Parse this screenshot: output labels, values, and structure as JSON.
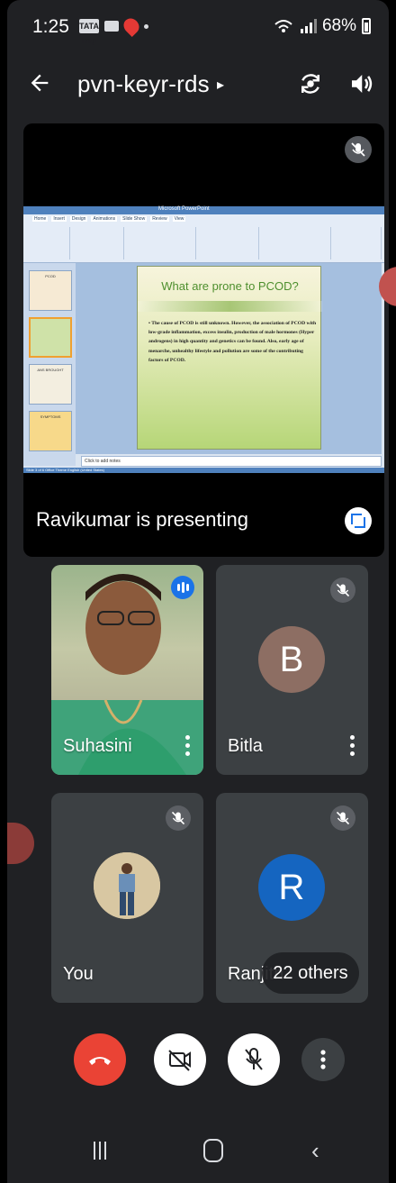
{
  "status_bar": {
    "time": "1:25",
    "carrier_icon_text": "TATA img",
    "battery": "68%"
  },
  "meeting": {
    "title": "pvn-keyr-rds",
    "title_chevron": "▸"
  },
  "presentation": {
    "caption": "Ravikumar is presenting",
    "app_title": "Microsoft PowerPoint",
    "ribbon_tabs": [
      "Home",
      "Insert",
      "Design",
      "Animations",
      "Slide Show",
      "Review",
      "View"
    ],
    "slide_title": "What are prone to PCOD?",
    "slide_body": "• The cause of PCOD is still unknown. However, the association of PCOD with low-grade inflammation, excess insulin, production of male hormones (Hyper androgens) in high quantity and genetics can be found. Also, early age of menarche, unhealthy lifestyle and pollution are some of the contributing factors of PCOD.",
    "notes_placeholder": "Click to add notes",
    "thumbnails": [
      "PCOD",
      "",
      "ANS BROUGHT",
      "SYMPTOMS"
    ],
    "status_text": "Slide 3 of 6   Office Theme   English (United States)"
  },
  "participants": [
    {
      "name": "Suhasini",
      "speaking": true
    },
    {
      "name": "Bitla",
      "initial": "B",
      "muted": true
    },
    {
      "name": "You",
      "muted": true
    },
    {
      "name": "Ranjith",
      "initial": "R",
      "muted": true
    }
  ],
  "others_chip": "22 others",
  "colors": {
    "background": "#202124",
    "tile": "#3c4043",
    "hangup": "#ea4335",
    "accent": "#1a73e8",
    "avatar_b": "#8d6e63",
    "avatar_r": "#1565c0"
  },
  "icons": {
    "back": "arrow-back-icon",
    "flip_camera": "flip-camera-icon",
    "speaker": "speaker-icon",
    "mic_off": "mic-off-icon",
    "cam_off": "camera-off-icon",
    "hangup": "hangup-icon",
    "more": "more-vert-icon",
    "fullscreen": "fullscreen-icon"
  }
}
